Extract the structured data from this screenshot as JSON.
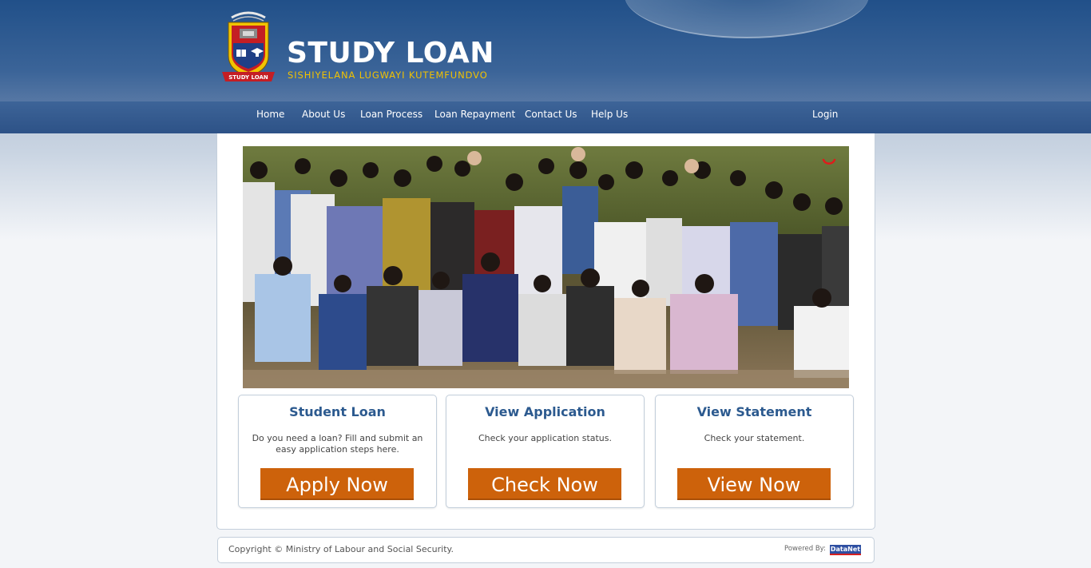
{
  "brand": {
    "title": "STUDY LOAN",
    "subtitle": "SISHIYELANA LUGWAYI KUTEMFUNDVO",
    "subtitle_color": "#f2c200",
    "logo_text": "STUDY LOAN"
  },
  "nav": {
    "items": [
      {
        "label": "Home"
      },
      {
        "label": "About Us"
      },
      {
        "label": "Loan Process"
      },
      {
        "label": "Loan Repayment"
      },
      {
        "label": "Contact Us"
      },
      {
        "label": "Help Us"
      }
    ],
    "login": "Login"
  },
  "cards": [
    {
      "title": "Student Loan",
      "text": "Do you need a loan? Fill and submit an easy application steps here.",
      "button": "Apply Now"
    },
    {
      "title": "View Application",
      "text": "Check your application status.",
      "button": "Check Now"
    },
    {
      "title": "View Statement",
      "text": "Check your statement.",
      "button": "View Now"
    }
  ],
  "footer": {
    "copyright": "Copyright © Ministry of Labour and Social Security.",
    "powered_by": "Powered By:",
    "powered_brand": "DataNet"
  },
  "colors": {
    "header": "#215089",
    "nav": "#2d5287",
    "accent_button": "#cd620b",
    "card_title": "#2c5a8f"
  },
  "icons": {
    "logo": "coat-of-arms-crest-icon",
    "loader": "loading-spinner-icon"
  }
}
